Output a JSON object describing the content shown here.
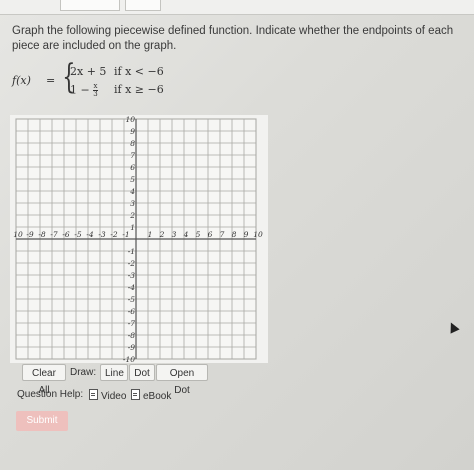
{
  "question": {
    "text": "Graph the following piecewise defined function. Indicate whether the endpoints of each piece are included on the graph."
  },
  "formula": {
    "lhs": "f(x)",
    "equals": "=",
    "brace": "{",
    "piece1_expr": "2x + 5",
    "piece1_cond": "if  x < −6",
    "piece2_expr_lead": "1 −",
    "piece2_frac_num": "x",
    "piece2_frac_den": "3",
    "piece2_cond": "if  x ≥ −6"
  },
  "graph": {
    "x_ticks": [
      "10",
      "-9",
      "-8",
      "-7",
      "-6",
      "-5",
      "-4",
      "-3",
      "-2",
      "-1",
      "1",
      "2",
      "3",
      "4",
      "5",
      "6",
      "7",
      "8",
      "9",
      "10"
    ],
    "x_tick_values": [
      -10,
      -9,
      -8,
      -7,
      -6,
      -5,
      -4,
      -3,
      -2,
      -1,
      1,
      2,
      3,
      4,
      5,
      6,
      7,
      8,
      9,
      10
    ],
    "y_ticks": [
      "10",
      "9",
      "8",
      "7",
      "6",
      "5",
      "4",
      "3",
      "2",
      "1",
      "-1",
      "-2",
      "-3",
      "-4",
      "-5",
      "-6",
      "-7",
      "-8",
      "-9",
      "-10"
    ],
    "y_tick_values": [
      10,
      9,
      8,
      7,
      6,
      5,
      4,
      3,
      2,
      1,
      -1,
      -2,
      -3,
      -4,
      -5,
      -6,
      -7,
      -8,
      -9,
      -10
    ],
    "xlim": [
      -10,
      10
    ],
    "ylim": [
      -10,
      10
    ],
    "grid": true
  },
  "tools": {
    "clear_all": "Clear All",
    "draw_label": "Draw:",
    "line": "Line",
    "dot": "Dot",
    "open_dot": "Open Dot"
  },
  "help": {
    "label": "Question Help:",
    "video": "Video",
    "ebook": "eBook"
  },
  "submit": "Submit"
}
